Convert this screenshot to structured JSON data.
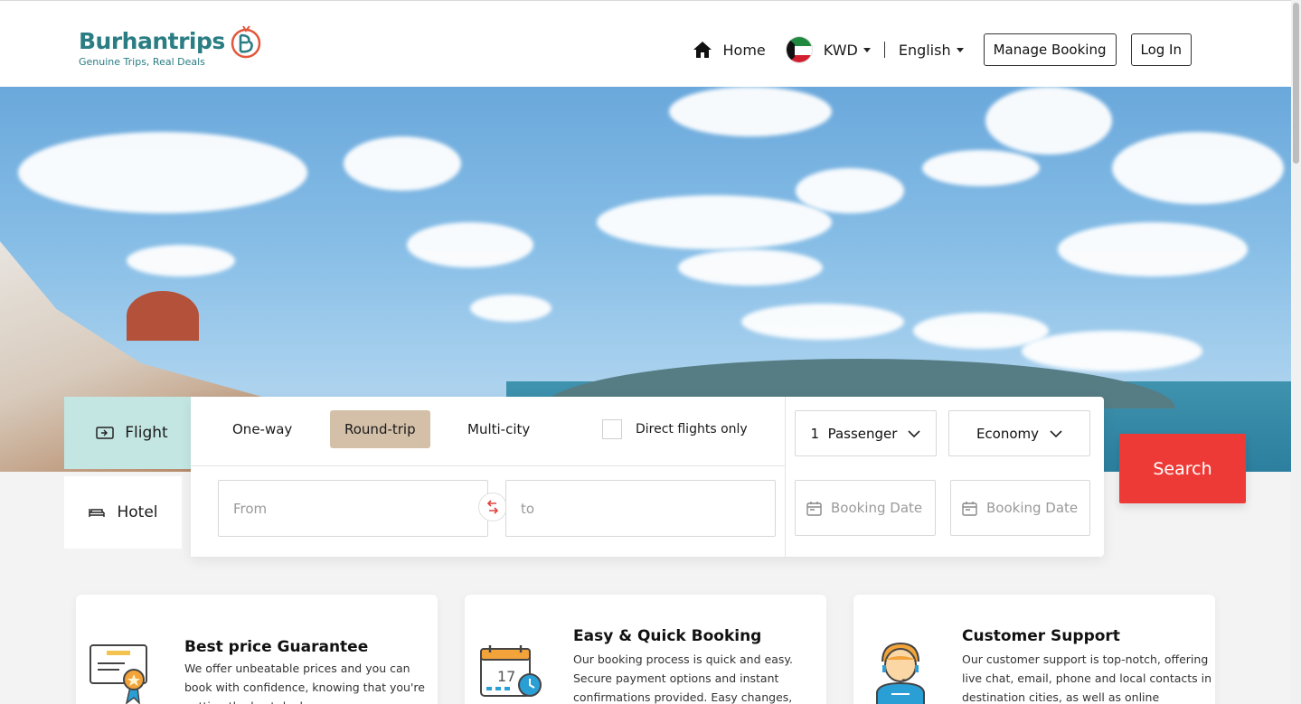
{
  "brand": {
    "name": "Burhantrips",
    "tagline": "Genuine Trips, Real Deals",
    "colors": {
      "primary": "#2a7d83",
      "accent": "#ee3a36",
      "tab_active": "#c3e6e3",
      "trip_active": "#d4c0a8"
    }
  },
  "nav": {
    "home": "Home",
    "currency": "KWD",
    "language": "English",
    "manage_booking": "Manage Booking",
    "login": "Log In"
  },
  "booking": {
    "tabs": [
      {
        "label": "Flight",
        "icon": "plane-ticket-icon",
        "active": true
      },
      {
        "label": "Hotel",
        "icon": "bed-icon",
        "active": false
      }
    ],
    "trip_types": [
      {
        "label": "One-way",
        "active": false
      },
      {
        "label": "Round-trip",
        "active": true
      },
      {
        "label": "Multi-city",
        "active": false
      }
    ],
    "direct_flights_label": "Direct flights only",
    "from_placeholder": "From",
    "to_placeholder": "to",
    "passengers": "1  Passenger",
    "cabin_class": "Economy",
    "departure_placeholder": "Booking Date",
    "return_placeholder": "Booking Date",
    "search_label": "Search"
  },
  "features": [
    {
      "title": "Best price Guarantee",
      "icon": "certificate-icon",
      "text": "We offer unbeatable prices and you can book with confidence, knowing that you're getting the best deal."
    },
    {
      "title": "Easy & Quick Booking",
      "icon": "calendar-clock-icon",
      "text": "Our booking process is quick and easy. Secure payment options and instant confirmations provided. Easy changes,"
    },
    {
      "title": "Customer Support",
      "icon": "support-agent-icon",
      "text": "Our customer support is top-notch, offering live chat, email, phone and local contacts in destination cities, as well as online"
    }
  ]
}
